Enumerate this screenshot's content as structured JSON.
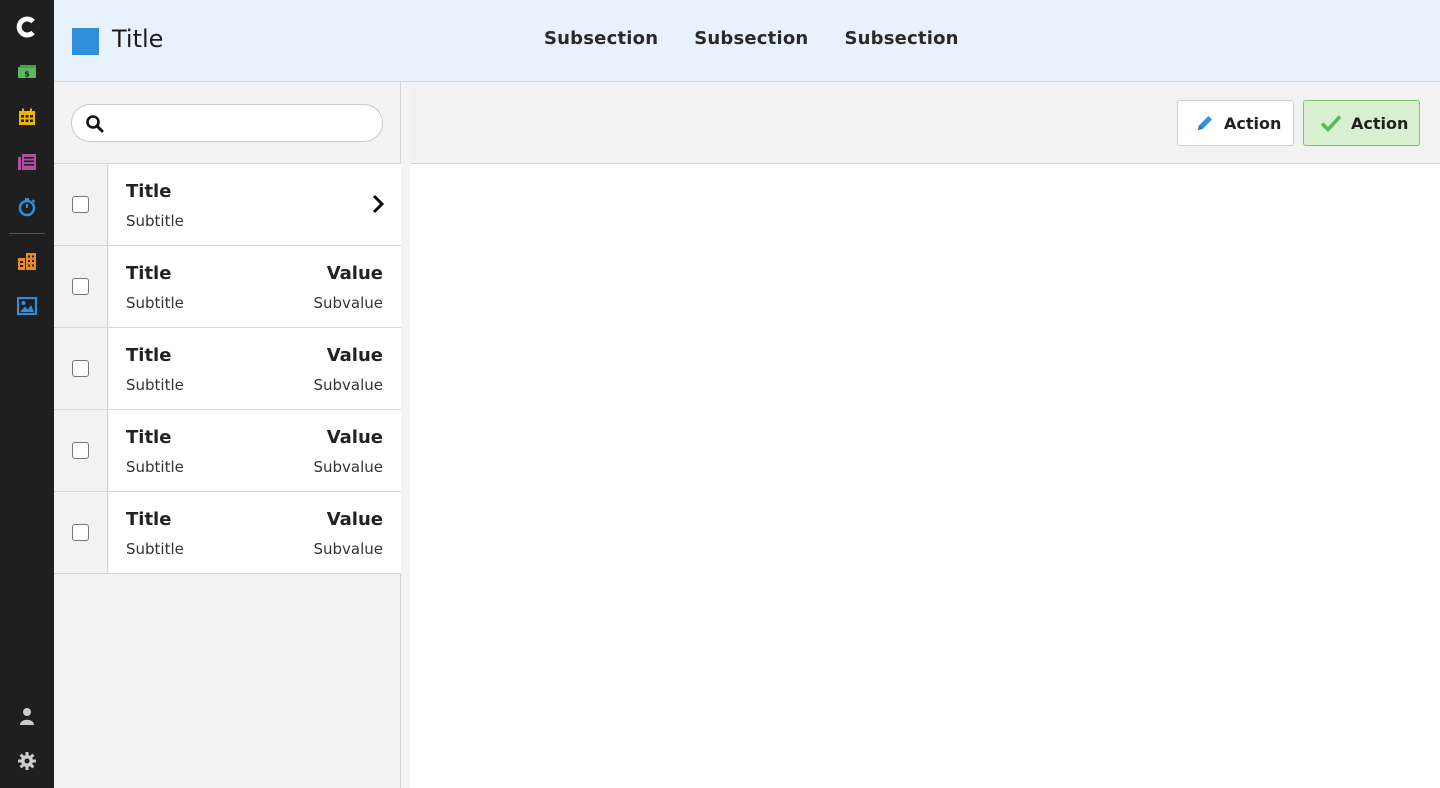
{
  "rail": {
    "logo": "c",
    "items": [
      {
        "icon": "money-icon",
        "color": "#5cb85c"
      },
      {
        "icon": "calendar-icon",
        "color": "#f0b400"
      },
      {
        "icon": "document-list-icon",
        "color": "#b04fa0"
      },
      {
        "icon": "stopwatch-icon",
        "color": "#2f8fdc"
      },
      {
        "icon": "building-icon",
        "color": "#e8892a"
      },
      {
        "icon": "image-icon",
        "color": "#2f8fdc"
      }
    ],
    "bottom": [
      {
        "icon": "user-icon",
        "color": "#cccccc"
      },
      {
        "icon": "gear-icon",
        "color": "#cccccc"
      }
    ]
  },
  "header": {
    "title": "Title",
    "brand_color": "#2f8fdc",
    "subsections": [
      "Subsection",
      "Subsection",
      "Subsection"
    ]
  },
  "search": {
    "placeholder": "",
    "value": ""
  },
  "list": {
    "rows": [
      {
        "title": "Title",
        "subtitle": "Subtitle",
        "value": "",
        "subvalue": "",
        "chevron": true
      },
      {
        "title": "Title",
        "subtitle": "Subtitle",
        "value": "Value",
        "subvalue": "Subvalue"
      },
      {
        "title": "Title",
        "subtitle": "Subtitle",
        "value": "Value",
        "subvalue": "Subvalue"
      },
      {
        "title": "Title",
        "subtitle": "Subtitle",
        "value": "Value",
        "subvalue": "Subvalue"
      },
      {
        "title": "Title",
        "subtitle": "Subtitle",
        "value": "Value",
        "subvalue": "Subvalue"
      }
    ]
  },
  "toolbar": {
    "edit_label": "Action",
    "confirm_label": "Action"
  }
}
